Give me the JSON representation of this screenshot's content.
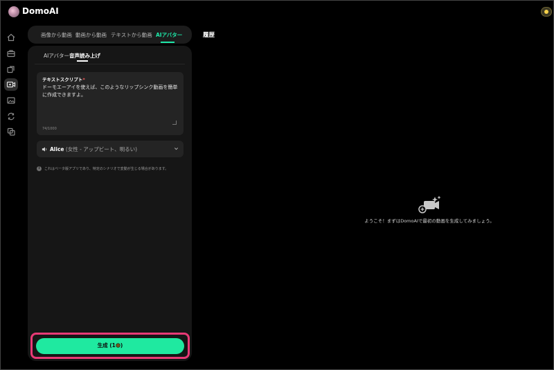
{
  "app": {
    "name": "DomoAI"
  },
  "colors": {
    "accent": "#1ee8a8",
    "highlight": "#e83a76",
    "panel": "#161616"
  },
  "sidebar": {
    "items": [
      {
        "icon": "home-icon"
      },
      {
        "icon": "briefcase-icon"
      },
      {
        "icon": "layers-icon"
      },
      {
        "icon": "video-avatar-icon",
        "active": true
      },
      {
        "icon": "image-icon"
      },
      {
        "icon": "refresh-icon"
      },
      {
        "icon": "copy-icon"
      }
    ]
  },
  "tabs": {
    "items": [
      {
        "label": "画像から動画"
      },
      {
        "label": "動画から動画"
      },
      {
        "label": "テキストから動画"
      },
      {
        "label": "AIアバター",
        "active": true
      }
    ],
    "history_label": "履歴"
  },
  "subtabs": {
    "items": [
      {
        "label": "AIアバター"
      },
      {
        "label": "音声読み上げ",
        "active": true
      }
    ]
  },
  "script": {
    "label": "テキストスクリプト",
    "required_mark": "*",
    "text": "ドーモエーアイを使えば、このようなリップシンク動画を簡単に作成できますよ。",
    "char_count": "74/1000"
  },
  "voice": {
    "name": "Alice",
    "description": "(女性 - アップビート、明るい)"
  },
  "note": {
    "text": "これはベータ版アプリであり、特定のシナリオで変動が生じる場合があります。"
  },
  "generate": {
    "label": "生成 (1",
    "label_end": ")"
  },
  "empty_state": {
    "text": "ようこそ！まずはDomoAIで最初の動画を生成してみましょう。"
  }
}
